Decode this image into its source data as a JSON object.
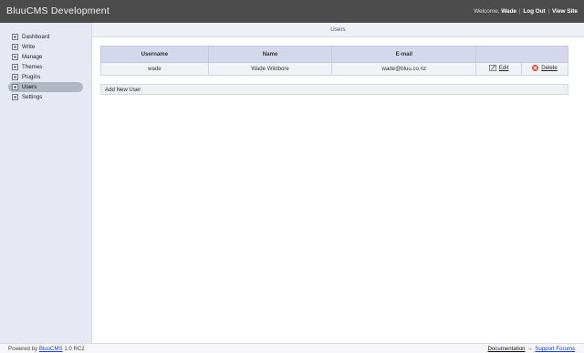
{
  "app": {
    "title": "BluuCMS Development"
  },
  "topbar": {
    "welcome_label": "Welcome,",
    "username": "Wade",
    "logout_label": "Log Out",
    "viewsite_label": "View Site",
    "separator": "|"
  },
  "sidebar": {
    "items": [
      {
        "label": "Dashboard",
        "icon": "dashboard-icon"
      },
      {
        "label": "Write",
        "icon": "write-icon"
      },
      {
        "label": "Manage",
        "icon": "manage-icon"
      },
      {
        "label": "Themes",
        "icon": "themes-icon"
      },
      {
        "label": "Plugins",
        "icon": "plugins-icon"
      },
      {
        "label": "Users",
        "icon": "users-icon",
        "active": true
      },
      {
        "label": "Settings",
        "icon": "settings-icon"
      }
    ]
  },
  "main": {
    "section_title": "Users",
    "table": {
      "headers": [
        "Username",
        "Name",
        "E-mail",
        ""
      ],
      "rows": [
        {
          "username": "wade",
          "name": "Wade Wildbore",
          "email": "wade@bluu.co.nz",
          "edit_label": "Edit",
          "delete_label": "Delete"
        }
      ]
    },
    "add_user_label": "Add New User"
  },
  "footer": {
    "powered_prefix": "Powered by",
    "powered_link": "BluuCMS",
    "version": "1.0 RC2",
    "documentation_label": "Documentation",
    "support_label": "Support Forums",
    "separator": "–"
  },
  "colors": {
    "topbar_bg": "#4c4c4c",
    "sidebar_bg": "#e6e8f4",
    "active_item_bg": "#b3b7c4",
    "table_header_bg": "#d4d8ed",
    "link_blue": "#2343b8",
    "delete_red": "#d9463c"
  }
}
